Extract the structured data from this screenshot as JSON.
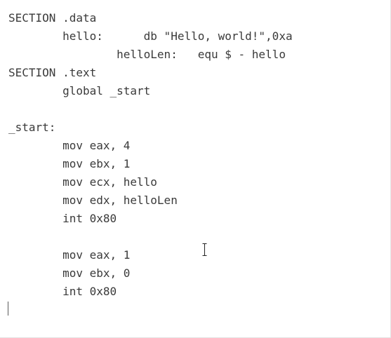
{
  "editor": {
    "lines": [
      "SECTION .data",
      "        hello:      db \"Hello, world!\",0xa",
      "                helloLen:   equ $ - hello",
      "SECTION .text",
      "        global _start",
      "",
      "_start:",
      "        mov eax, 4",
      "        mov ebx, 1",
      "        mov ecx, hello",
      "        mov edx, helloLen",
      "        int 0x80",
      "",
      "        mov eax, 1",
      "        mov ebx, 0",
      "        int 0x80",
      ""
    ]
  },
  "icons": {
    "mouse_pointer": "ibeam-cursor-icon"
  }
}
